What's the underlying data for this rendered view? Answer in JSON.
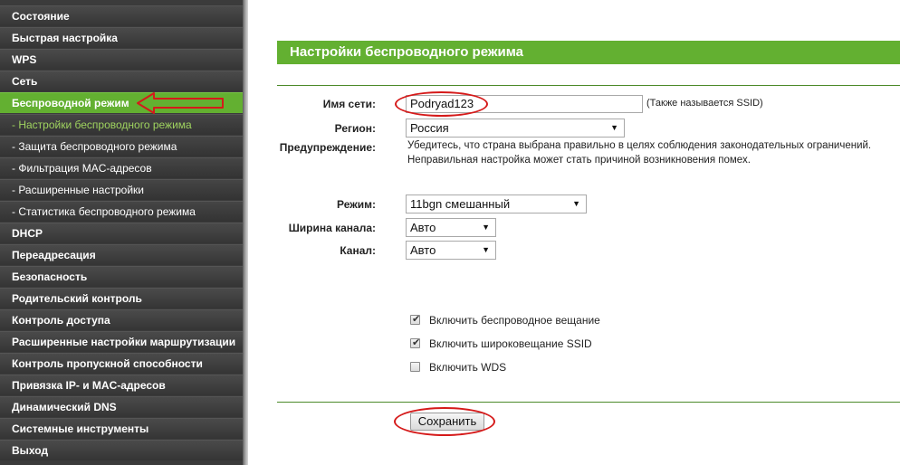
{
  "sidebar": {
    "items": [
      {
        "label": "Состояние"
      },
      {
        "label": "Быстрая настройка"
      },
      {
        "label": "WPS"
      },
      {
        "label": "Сеть"
      },
      {
        "label": "Беспроводной режим"
      },
      {
        "label": "- Настройки беспроводного режима"
      },
      {
        "label": "- Защита беспроводного режима"
      },
      {
        "label": "- Фильтрация MAC-адресов"
      },
      {
        "label": "- Расширенные настройки"
      },
      {
        "label": "- Статистика беспроводного режима"
      },
      {
        "label": "DHCP"
      },
      {
        "label": "Переадресация"
      },
      {
        "label": "Безопасность"
      },
      {
        "label": "Родительский контроль"
      },
      {
        "label": "Контроль доступа"
      },
      {
        "label": "Расширенные настройки маршрутизации"
      },
      {
        "label": "Контроль пропускной способности"
      },
      {
        "label": "Привязка IP- и MAC-адресов"
      },
      {
        "label": "Динамический DNS"
      },
      {
        "label": "Системные инструменты"
      },
      {
        "label": "Выход"
      }
    ]
  },
  "main": {
    "title": "Настройки беспроводного режима",
    "ssid_label": "Имя сети:",
    "ssid_value": "Podryad123",
    "ssid_hint": "(Также называется SSID)",
    "region_label": "Регион:",
    "region_value": "Россия",
    "warning_label": "Предупреждение:",
    "warning_line1": "Убедитесь, что страна выбрана правильно в целях соблюдения законодательных ограничений.",
    "warning_line2": "Неправильная настройка может стать причиной возникновения помех.",
    "mode_label": "Режим:",
    "mode_value": "11bgn смешанный",
    "width_label": "Ширина канала:",
    "width_value": "Авто",
    "channel_label": "Канал:",
    "channel_value": "Авто",
    "cb_broadcast": "Включить беспроводное вещание",
    "cb_ssid": "Включить широковещание SSID",
    "cb_wds": "Включить WDS",
    "save_label": "Сохранить"
  },
  "checkboxes": {
    "broadcast": true,
    "ssid": true,
    "wds": false
  },
  "colors": {
    "accent": "#63b031",
    "sidebar": "#3b3b3b",
    "annotation": "#d51a1a"
  }
}
